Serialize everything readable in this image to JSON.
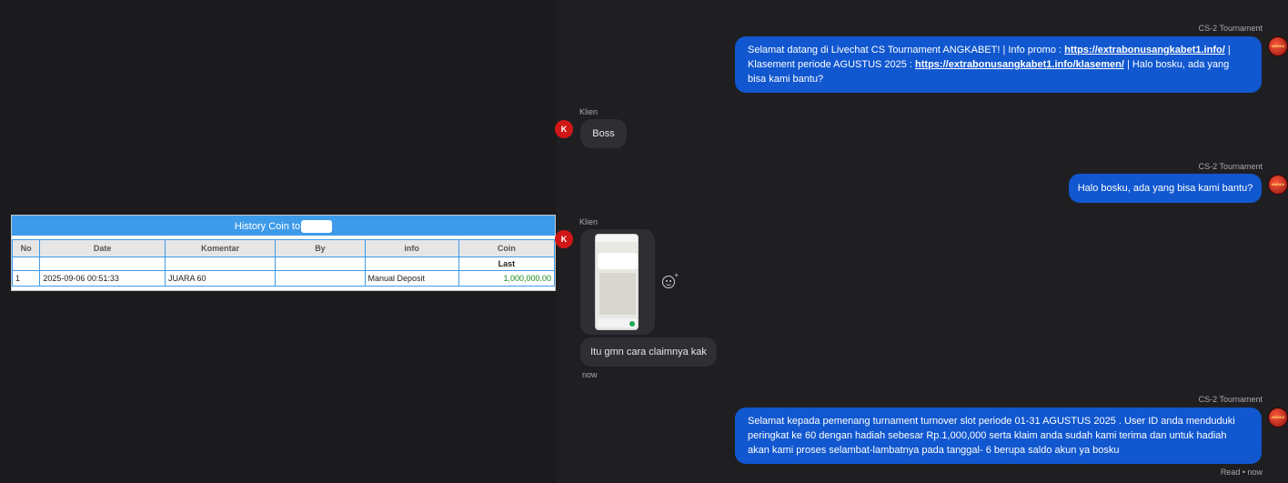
{
  "history_table": {
    "title": "History Coin to",
    "headers": [
      "No",
      "Date",
      "Komentar",
      "By",
      "info",
      "Coin"
    ],
    "subheader_last": "Last",
    "rows": [
      {
        "no": "1",
        "date": "2025-09-06 00:51:33",
        "komentar": "JUARA 60",
        "by": "",
        "info": "Manual Deposit",
        "coin": "1,000,000.00"
      }
    ]
  },
  "chat": {
    "cs_sender": "CS-2 Tournament",
    "client_sender": "Klien",
    "client_avatar_letter": "K",
    "cs_avatar_text": "ANGKA",
    "messages": {
      "m1": {
        "p1": "Selamat datang di Livechat CS Tournament ANGKABET! | Info promo : ",
        "link1": "https://extrabonusangkabet1.info/",
        "p2": " | Klasement periode AGUSTUS 2025 : ",
        "link2": "https://extrabonusangkabet1.info/klasemen/",
        "p3": " | Halo bosku, ada yang bisa kami bantu?"
      },
      "m2": "Boss",
      "m3": "Halo bosku, ada yang bisa kami bantu?",
      "m5": "Itu gmn cara claimnya kak",
      "m5_time": "now",
      "m6": "Selamat kepada pemenang turnament turnover slot periode 01-31 AGUSTUS 2025 . User ID anda menduduki peringkat ke 60 dengan hadiah sebesar Rp.1,000,000 serta klaim anda sudah kami terima dan untuk hadiah akan kami proses selambat-lambatnya pada tanggal- 6 berupa saldo akun ya bosku",
      "m6_status": "Read • now"
    }
  },
  "colors": {
    "accent_blue": "#1157cf",
    "table_blue": "#3d9be9",
    "client_red": "#d11616",
    "coin_green": "#1a8a1a"
  }
}
